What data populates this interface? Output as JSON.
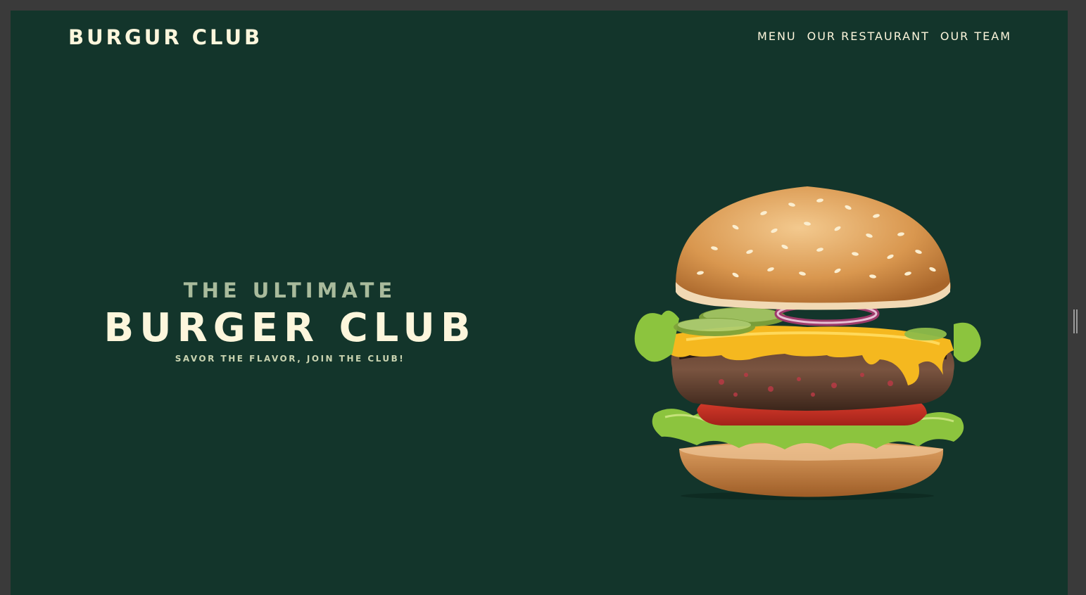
{
  "header": {
    "logo": "BURGUR CLUB",
    "nav": [
      {
        "label": "MENU"
      },
      {
        "label": "OUR RESTAURANT"
      },
      {
        "label": "OUR TEAM"
      }
    ]
  },
  "hero": {
    "eyebrow": "THE ULTIMATE",
    "title": "BURGER CLUB",
    "tagline": "SAVOR THE FLAVOR, JOIN THE CLUB!"
  },
  "colors": {
    "background": "#13352b",
    "cream": "#fdf6dc",
    "sage": "#a9bb9c"
  }
}
